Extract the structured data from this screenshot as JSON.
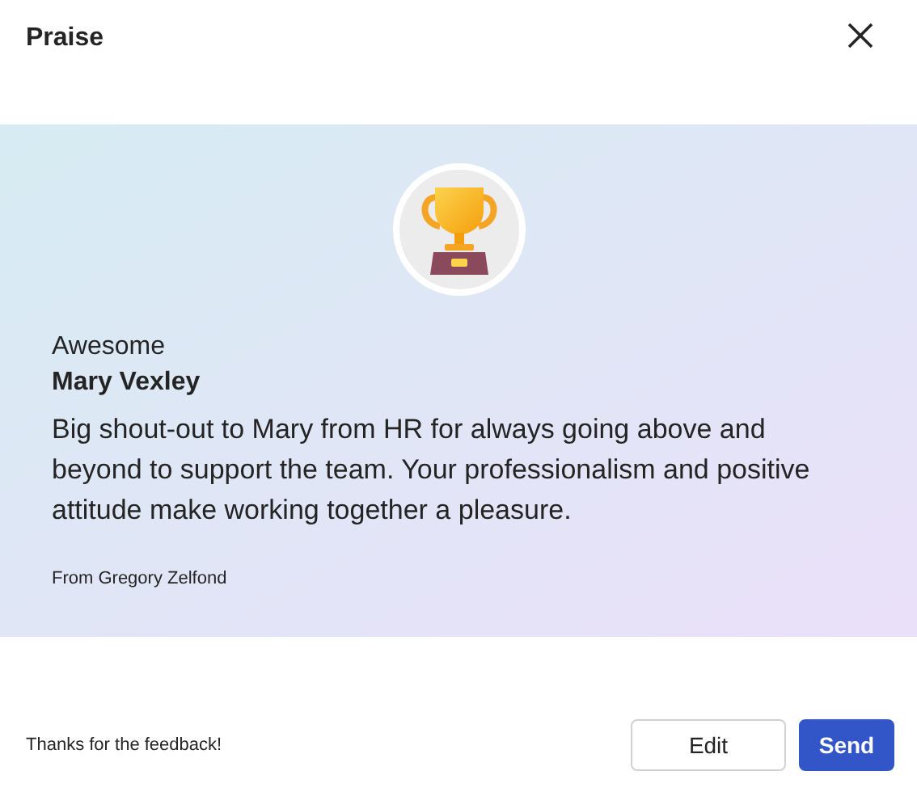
{
  "dialog": {
    "title": "Praise"
  },
  "praise_card": {
    "badge": "Awesome",
    "recipient": "Mary Vexley",
    "message": "Big shout-out to Mary from HR for always going above and beyond to support the team. Your professionalism and positive attitude make working together a pleasure.",
    "sender": "From Gregory Zelfond"
  },
  "footer": {
    "status": "Thanks for the feedback!",
    "buttons": [
      {
        "label": "Edit",
        "kind": "secondary"
      },
      {
        "label": "Send",
        "kind": "primary"
      }
    ]
  }
}
